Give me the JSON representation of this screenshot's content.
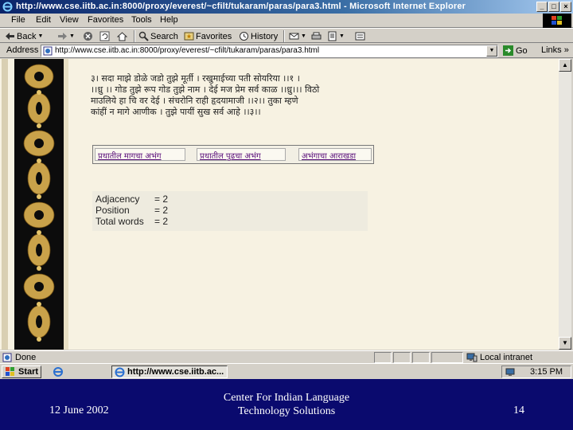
{
  "window": {
    "title": "http://www.cse.iitb.ac.in:8000/proxy/everest/~cfilt/tukaram/paras/para3.html - Microsoft Internet Explorer",
    "minimize": "_",
    "maximize": "□",
    "close": "×"
  },
  "menu": [
    "File",
    "Edit",
    "View",
    "Favorites",
    "Tools",
    "Help"
  ],
  "toolbar": {
    "back": "Back",
    "search": "Search",
    "favorites": "Favorites",
    "history": "History"
  },
  "address": {
    "label": "Address",
    "url": "http://www.cse.iitb.ac.in:8000/proxy/everest/~cfilt/tukaram/paras/para3.html",
    "go": "Go",
    "links": "Links »"
  },
  "page": {
    "poem_lines": [
      "३। सदा माझे डोळे जडो तुझे मूर्ती । रखुमाईच्या पती सोयरिया ।।१ ।",
      "।।ध्रु ।। गोड तुझे रूप गोड तुझे नाम । देई मज प्रेम सर्व काळ ।।ध्रु।।। विठो",
      "माउलिये हा चि वर देई । संचरोनि राही हृदयामाजी ।।२।। तुका म्हणे",
      "कांहीं न मागे आणीक । तुझे पायीं सुख सर्व आहे ।।३।।"
    ],
    "nav_links": [
      "प्रथातील मागचा अभंग",
      "प्रथातील पुढचा अभंग",
      "अभंगाचा आराखडा"
    ],
    "stats": [
      {
        "key": "Adjacency",
        "value": "= 2"
      },
      {
        "key": "Position",
        "value": "= 2"
      },
      {
        "key": "Total words",
        "value": "= 2"
      }
    ]
  },
  "status": {
    "text": "Done",
    "zone": "Local intranet"
  },
  "taskbar": {
    "start": "Start",
    "task": "http://www.cse.iitb.ac...",
    "clock": "3:15 PM"
  },
  "footer": {
    "date": "12 June 2002",
    "center_line1": "Center For Indian Language",
    "center_line2": "Technology Solutions",
    "page": "14"
  },
  "colors": {
    "title_gradient_start": "#0a246a",
    "chrome": "#d4d0c8",
    "page_bg": "#f7f2e2",
    "link": "#5a0f7a",
    "slide_bg": "#0a0a6e"
  }
}
